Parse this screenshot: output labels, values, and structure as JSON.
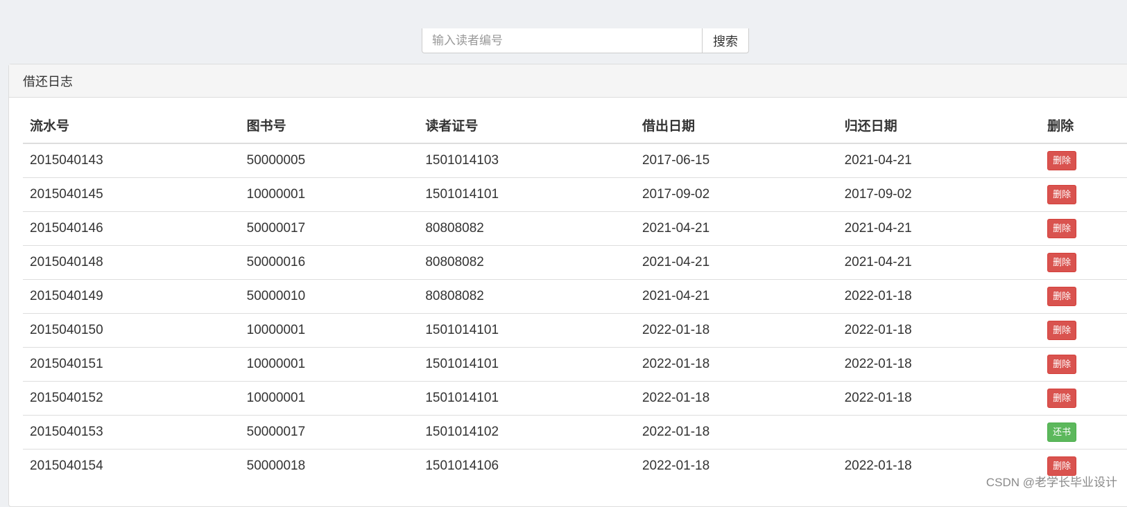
{
  "search": {
    "placeholder": "输入读者编号",
    "button_label": "搜索"
  },
  "panel": {
    "title": "借还日志"
  },
  "table": {
    "headers": [
      "流水号",
      "图书号",
      "读者证号",
      "借出日期",
      "归还日期",
      "删除"
    ],
    "rows": [
      {
        "serial": "2015040143",
        "book": "50000005",
        "reader": "1501014103",
        "out": "2017-06-15",
        "ret": "2021-04-21",
        "action": "删除",
        "action_type": "danger"
      },
      {
        "serial": "2015040145",
        "book": "10000001",
        "reader": "1501014101",
        "out": "2017-09-02",
        "ret": "2017-09-02",
        "action": "删除",
        "action_type": "danger"
      },
      {
        "serial": "2015040146",
        "book": "50000017",
        "reader": "80808082",
        "out": "2021-04-21",
        "ret": "2021-04-21",
        "action": "删除",
        "action_type": "danger"
      },
      {
        "serial": "2015040148",
        "book": "50000016",
        "reader": "80808082",
        "out": "2021-04-21",
        "ret": "2021-04-21",
        "action": "删除",
        "action_type": "danger"
      },
      {
        "serial": "2015040149",
        "book": "50000010",
        "reader": "80808082",
        "out": "2021-04-21",
        "ret": "2022-01-18",
        "action": "删除",
        "action_type": "danger"
      },
      {
        "serial": "2015040150",
        "book": "10000001",
        "reader": "1501014101",
        "out": "2022-01-18",
        "ret": "2022-01-18",
        "action": "删除",
        "action_type": "danger"
      },
      {
        "serial": "2015040151",
        "book": "10000001",
        "reader": "1501014101",
        "out": "2022-01-18",
        "ret": "2022-01-18",
        "action": "删除",
        "action_type": "danger"
      },
      {
        "serial": "2015040152",
        "book": "10000001",
        "reader": "1501014101",
        "out": "2022-01-18",
        "ret": "2022-01-18",
        "action": "删除",
        "action_type": "danger"
      },
      {
        "serial": "2015040153",
        "book": "50000017",
        "reader": "1501014102",
        "out": "2022-01-18",
        "ret": "",
        "action": "还书",
        "action_type": "success"
      },
      {
        "serial": "2015040154",
        "book": "50000018",
        "reader": "1501014106",
        "out": "2022-01-18",
        "ret": "2022-01-18",
        "action": "删除",
        "action_type": "danger"
      }
    ]
  },
  "colors": {
    "danger": "#d9534f",
    "success": "#5cb85c",
    "page_background": "#eef0f3"
  },
  "watermark": "CSDN @老学长毕业设计"
}
